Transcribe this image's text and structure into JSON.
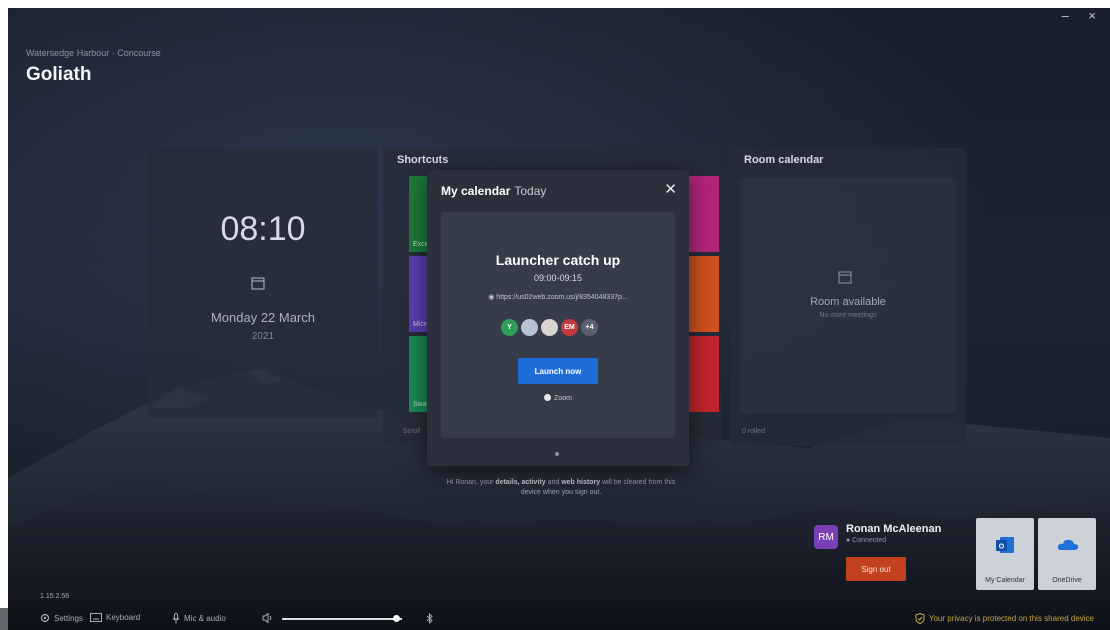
{
  "window": {
    "controls": "– ×"
  },
  "header": {
    "breadcrumb": "Watersedge Harbour · Concourse",
    "room_name": "Goliath"
  },
  "clock": {
    "time": "08:10",
    "date": "Monday 22 March",
    "year": "2021"
  },
  "shortcuts": {
    "title": "Shortcuts",
    "tiles": [
      {
        "label": "Excel",
        "color": "#1e7a3c"
      },
      {
        "label": "Micro",
        "color": "#5a3fb0"
      },
      {
        "label": "Sway",
        "color": "#1a8a56"
      },
      {
        "label": "",
        "color": "#b3257a"
      },
      {
        "label": "",
        "color": "#d0511f"
      },
      {
        "label": "",
        "color": "#c0262d"
      }
    ],
    "footer": "Scroll"
  },
  "room_calendar": {
    "title": "Room calendar",
    "status": "Room available",
    "subtitle": "No more meetings",
    "footer": "0 rolled"
  },
  "modal": {
    "title": "My calendar",
    "subtitle": "Today",
    "close_icon": "close-icon",
    "meeting": {
      "title": "Launcher catch up",
      "time": "09:00-09:15",
      "link": "https://us02web.zoom.us/j/8354048337p...",
      "attendees": [
        {
          "initials": "Y",
          "color": "#2f9e58"
        },
        {
          "initials": "",
          "color": "#b9c2d0"
        },
        {
          "initials": "",
          "color": "#d9d4cf"
        },
        {
          "initials": "EM",
          "color": "#c23b3b"
        },
        {
          "initials": "+4",
          "color": "#5b6170"
        }
      ],
      "launch_label": "Launch now",
      "provider": "Zoom"
    }
  },
  "privacy_message": {
    "prefix": "Hi Ronan, your",
    "bold": "details, activity",
    "middle": "and",
    "bold2": "web history",
    "suffix": "will be cleared from this device when you sign out."
  },
  "user": {
    "initials": "RM",
    "name": "Ronan McAleenan",
    "status": "● Connected",
    "signout_label": "Sign out"
  },
  "apps": [
    {
      "label": "My Calendar",
      "icon": "outlook-icon"
    },
    {
      "label": "OneDrive",
      "icon": "onedrive-icon"
    }
  ],
  "version": "1.15.2.56",
  "taskbar": {
    "settings": "Settings",
    "keyboard": "Keyboard",
    "mic": "Mic & audio",
    "volume_level": 0.95,
    "privacy_note": "Your privacy is protected on this shared device"
  }
}
